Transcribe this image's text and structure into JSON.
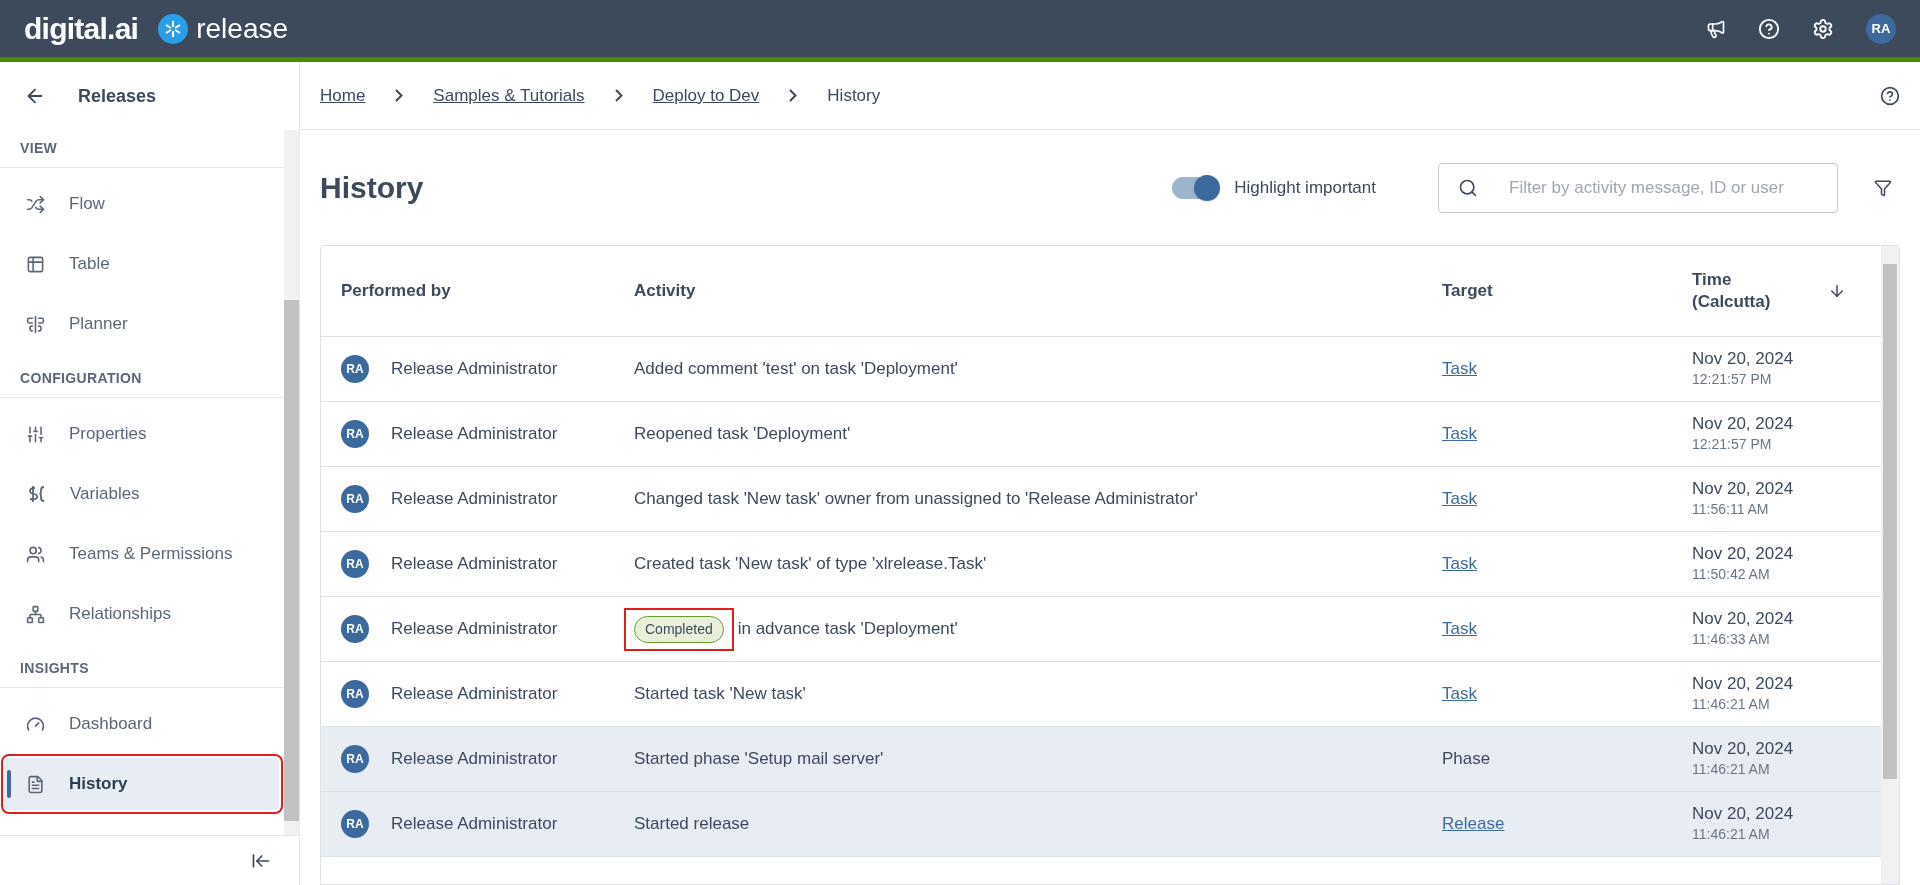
{
  "header": {
    "brand": "digital.ai",
    "product": "release",
    "user_initials": "RA"
  },
  "sidebar": {
    "back_label": "Releases",
    "sections": [
      {
        "title": "VIEW",
        "items": [
          {
            "label": "Flow",
            "kind": "flow",
            "selected": false,
            "annotated": false
          },
          {
            "label": "Table",
            "kind": "table",
            "selected": false,
            "annotated": false
          },
          {
            "label": "Planner",
            "kind": "planner",
            "selected": false,
            "annotated": false
          }
        ]
      },
      {
        "title": "CONFIGURATION",
        "items": [
          {
            "label": "Properties",
            "kind": "properties",
            "selected": false,
            "annotated": false
          },
          {
            "label": "Variables",
            "kind": "variables",
            "selected": false,
            "annotated": false
          },
          {
            "label": "Teams & Permissions",
            "kind": "teams",
            "selected": false,
            "annotated": false
          },
          {
            "label": "Relationships",
            "kind": "relationships",
            "selected": false,
            "annotated": false
          }
        ]
      },
      {
        "title": "INSIGHTS",
        "items": [
          {
            "label": "Dashboard",
            "kind": "dashboard",
            "selected": false,
            "annotated": false
          },
          {
            "label": "History",
            "kind": "history",
            "selected": true,
            "annotated": true
          }
        ]
      }
    ]
  },
  "breadcrumb": [
    {
      "label": "Home",
      "link": true
    },
    {
      "label": "Samples & Tutorials",
      "link": true
    },
    {
      "label": "Deploy to Dev",
      "link": true
    },
    {
      "label": "History",
      "link": false
    }
  ],
  "page": {
    "title": "History",
    "highlight_toggle": {
      "label": "Highlight important",
      "on": true
    },
    "search": {
      "placeholder": "Filter by activity message, ID or user"
    }
  },
  "table": {
    "columns": [
      "Performed by",
      "Activity",
      "Target",
      "Time (Calcutta)"
    ],
    "rows": [
      {
        "initials": "RA",
        "user": "Release Administrator",
        "activity": "Added comment 'test' on task 'Deployment'",
        "target": "Task",
        "target_link": true,
        "date": "Nov 20, 2024",
        "time": "12:21:57 PM",
        "important": false
      },
      {
        "initials": "RA",
        "user": "Release Administrator",
        "activity": "Reopened task 'Deployment'",
        "target": "Task",
        "target_link": true,
        "date": "Nov 20, 2024",
        "time": "12:21:57 PM",
        "important": false
      },
      {
        "initials": "RA",
        "user": "Release Administrator",
        "activity": "Changed task 'New task' owner from unassigned to 'Release Administrator'",
        "target": "Task",
        "target_link": true,
        "date": "Nov 20, 2024",
        "time": "11:56:11 AM",
        "important": false
      },
      {
        "initials": "RA",
        "user": "Release Administrator",
        "activity": "Created task 'New task' of type 'xlrelease.Task'",
        "target": "Task",
        "target_link": true,
        "date": "Nov 20, 2024",
        "time": "11:50:42 AM",
        "important": false
      },
      {
        "initials": "RA",
        "user": "Release Administrator",
        "badge": "Completed",
        "badge_annotated": true,
        "activity": "in advance task 'Deployment'",
        "target": "Task",
        "target_link": true,
        "date": "Nov 20, 2024",
        "time": "11:46:33 AM",
        "important": false
      },
      {
        "initials": "RA",
        "user": "Release Administrator",
        "activity": "Started task 'New task'",
        "target": "Task",
        "target_link": true,
        "date": "Nov 20, 2024",
        "time": "11:46:21 AM",
        "important": false
      },
      {
        "initials": "RA",
        "user": "Release Administrator",
        "activity": "Started phase 'Setup mail server'",
        "target": "Phase",
        "target_link": false,
        "date": "Nov 20, 2024",
        "time": "11:46:21 AM",
        "important": true
      },
      {
        "initials": "RA",
        "user": "Release Administrator",
        "activity": "Started release",
        "target": "Release",
        "target_link": true,
        "date": "Nov 20, 2024",
        "time": "11:46:21 AM",
        "important": true
      }
    ]
  }
}
